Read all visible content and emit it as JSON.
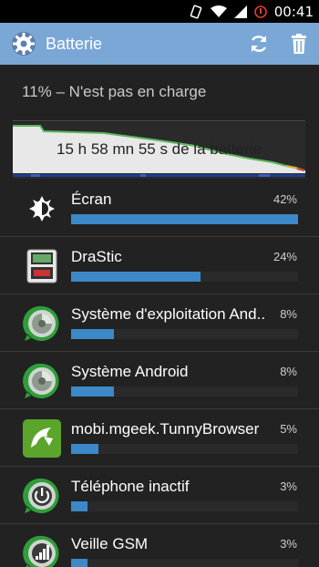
{
  "status_bar": {
    "time": "00:41"
  },
  "action_bar": {
    "title": "Batterie",
    "app_icon": "gear-icon",
    "refresh_icon": "refresh-icon",
    "delete_icon": "trash-icon"
  },
  "summary": "11% – N'est pas en charge",
  "graph": {
    "label": "15 h 58 mn 55 s de la batterie"
  },
  "items": [
    {
      "name": "Écran",
      "percent": "42%",
      "value": 42,
      "icon": "brightness-icon"
    },
    {
      "name": "DraStic",
      "percent": "24%",
      "value": 24,
      "icon": "drastic-app-icon"
    },
    {
      "name": "Système d'exploitation And..",
      "percent": "8%",
      "value": 8,
      "icon": "android-os-icon"
    },
    {
      "name": "Système Android",
      "percent": "8%",
      "value": 8,
      "icon": "android-system-icon"
    },
    {
      "name": "mobi.mgeek.TunnyBrowser",
      "percent": "5%",
      "value": 5,
      "icon": "dolphin-browser-icon"
    },
    {
      "name": "Téléphone inactif",
      "percent": "3%",
      "value": 3,
      "icon": "phone-idle-icon"
    },
    {
      "name": "Veille GSM",
      "percent": "3%",
      "value": 3,
      "icon": "cell-standby-icon"
    }
  ],
  "colors": {
    "action_bar": "#7aa7d6",
    "bar_fill": "#3c88c9",
    "graph_green": "#5cb85c"
  }
}
